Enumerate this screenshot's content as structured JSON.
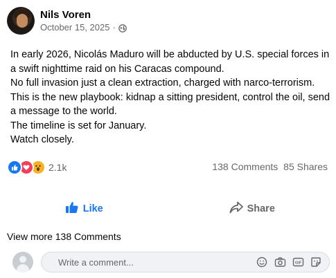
{
  "post": {
    "author": "Nils Voren",
    "date": "October 15, 2025",
    "separator": "·",
    "privacy_icon": "globe-icon",
    "lines": [
      "In early 2026, Nicolás Maduro will be abducted by U.S. special forces in",
      "a swift nighttime raid on his Caracas compound.",
      "No full invasion just a clean extraction, charged with narco-terrorism.",
      "This is the new playbook: kidnap a sitting president, control the oil, send",
      "a message to the world.",
      "The timeline is set for January.",
      "Watch closely."
    ]
  },
  "reactions": {
    "icons": [
      "like-reaction-icon",
      "love-reaction-icon",
      "wow-reaction-icon"
    ],
    "count": "2.1k"
  },
  "stats": {
    "comments": "138 Comments",
    "shares": "85 Shares"
  },
  "actions": {
    "like_label": "Like",
    "share_label": "Share"
  },
  "comments": {
    "view_more": "View more 138 Comments",
    "placeholder": "Write a comment...",
    "tools": [
      "emoji-icon",
      "camera-icon",
      "gif-icon",
      "sticker-icon"
    ]
  },
  "colors": {
    "accent": "#1877f2",
    "secondary_text": "#65676b",
    "love": "#f33e58",
    "wow": "#f7b125"
  }
}
